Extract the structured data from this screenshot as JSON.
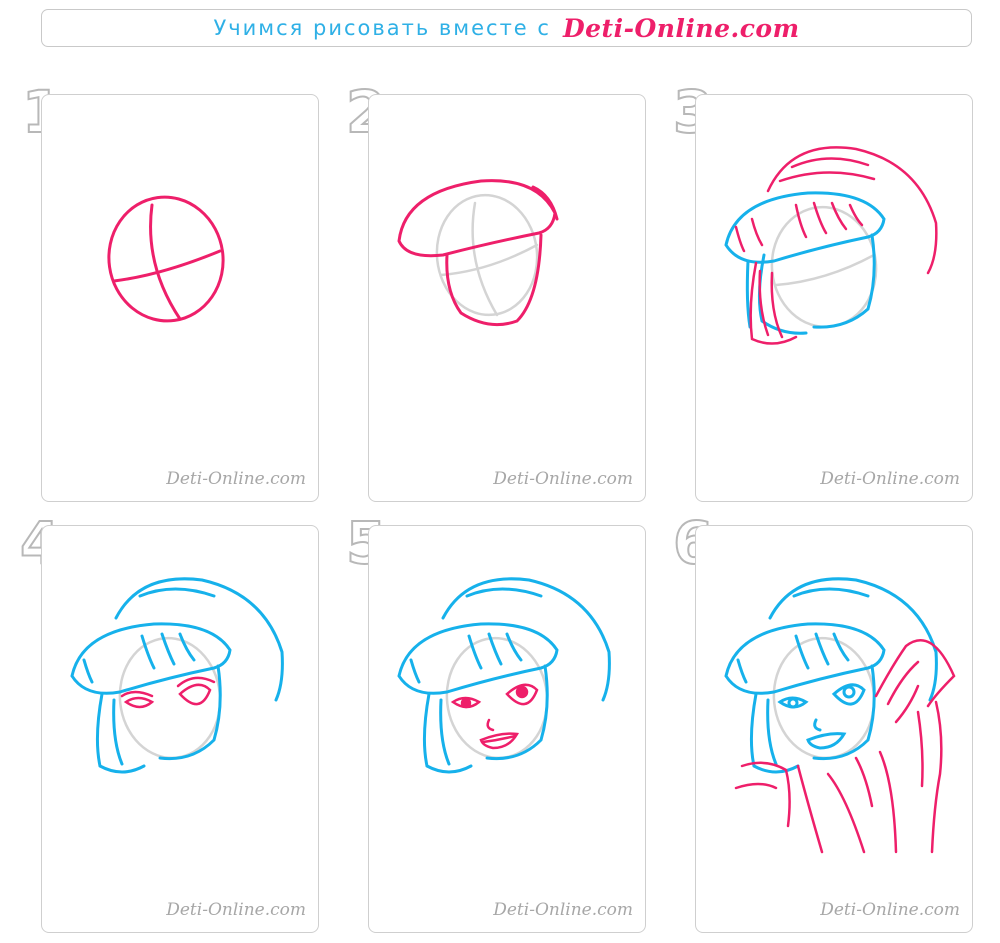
{
  "header": {
    "text": "Учимся рисовать вместе с",
    "brand": "Deti-Online.com"
  },
  "colors": {
    "pink": "#ee1f6a",
    "blue": "#16b1eb",
    "gray": "#d4d4d4"
  },
  "steps": [
    {
      "number": "1",
      "watermark": "Deti-Online.com"
    },
    {
      "number": "2",
      "watermark": "Deti-Online.com"
    },
    {
      "number": "3",
      "watermark": "Deti-Online.com"
    },
    {
      "number": "4",
      "watermark": "Deti-Online.com"
    },
    {
      "number": "5",
      "watermark": "Deti-Online.com"
    },
    {
      "number": "6",
      "watermark": "Deti-Online.com"
    }
  ]
}
